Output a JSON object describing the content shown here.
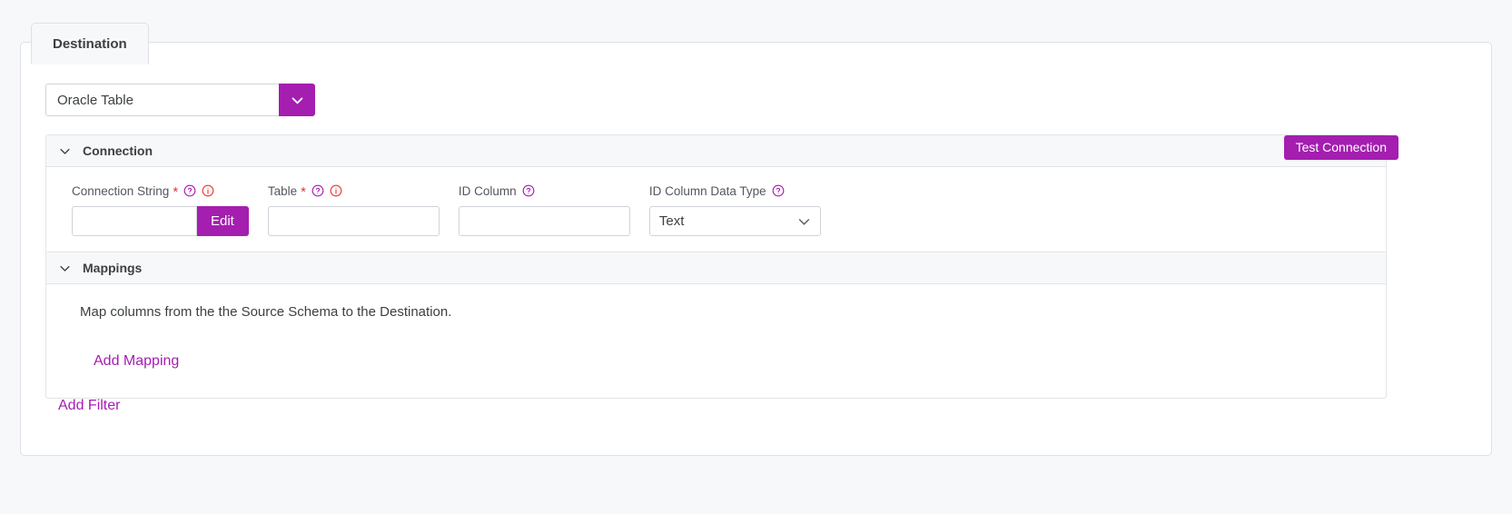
{
  "colors": {
    "accent_purple": "#a41eb0",
    "required_red": "#e8372c",
    "text_dark": "#3c4043",
    "label_gray": "#53575c",
    "border_gray": "#cfd4da",
    "panel_border": "#dfe1e5",
    "page_bg": "#f7f8f9",
    "section_header_bg": "#f7f8fa"
  },
  "tabs": [
    {
      "label": "Destination",
      "active": true
    }
  ],
  "destination_select": {
    "value": "Oracle Table",
    "chevron_icon": "chevron-down-icon"
  },
  "connection_section": {
    "title": "Connection",
    "collapse_icon": "chevron-down-icon",
    "test_connection_label": "Test Connection",
    "fields": [
      {
        "label": "Connection String",
        "required": true,
        "required_marker": "*",
        "help_icon": "question-circle-icon",
        "error_icon": "info-circle-icon",
        "value": "",
        "placeholder": "",
        "button_label": "Edit",
        "type": "text-with-button"
      },
      {
        "label": "Table",
        "required": true,
        "required_marker": "*",
        "help_icon": "question-circle-icon",
        "error_icon": "info-circle-icon",
        "value": "",
        "placeholder": "",
        "type": "text"
      },
      {
        "label": "ID Column",
        "required": false,
        "help_icon": "question-circle-icon",
        "value": "",
        "placeholder": "",
        "type": "text"
      },
      {
        "label": "ID Column Data Type",
        "required": false,
        "help_icon": "question-circle-icon",
        "value": "Text",
        "options": [
          "Text"
        ],
        "chevron_icon": "chevron-down-icon",
        "type": "select"
      }
    ]
  },
  "mappings_section": {
    "title": "Mappings",
    "collapse_icon": "chevron-down-icon",
    "description": "Map columns from the the Source Schema to the Destination.",
    "add_mapping_label": "Add Mapping"
  },
  "add_filter_label": "Add Filter"
}
